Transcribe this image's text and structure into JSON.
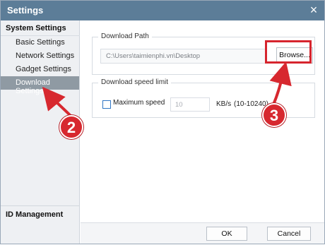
{
  "window": {
    "title": "Settings",
    "close_glyph": "×",
    "accent_color": "#5c7d98"
  },
  "sidebar": {
    "header": "System Settings",
    "items": [
      {
        "label": "Basic Settings"
      },
      {
        "label": "Network Settings"
      },
      {
        "label": "Gadget Settings"
      },
      {
        "label": "Download Settings",
        "active": true
      }
    ],
    "footer": "ID Management"
  },
  "download_path": {
    "legend": "Download Path",
    "value": "C:\\Users\\taimienphi.vn\\Desktop",
    "browse_label": "Browse..."
  },
  "speed_limit": {
    "legend": "Download speed limit",
    "checkbox_label": "Maximum speed",
    "checked": false,
    "speed_value": "10",
    "unit": "KB/s",
    "range": "(10-10240)"
  },
  "footer": {
    "ok_label": "OK",
    "cancel_label": "Cancel"
  },
  "annotations": {
    "step_2": "2",
    "step_3": "3",
    "marker_color": "#d7282f"
  }
}
